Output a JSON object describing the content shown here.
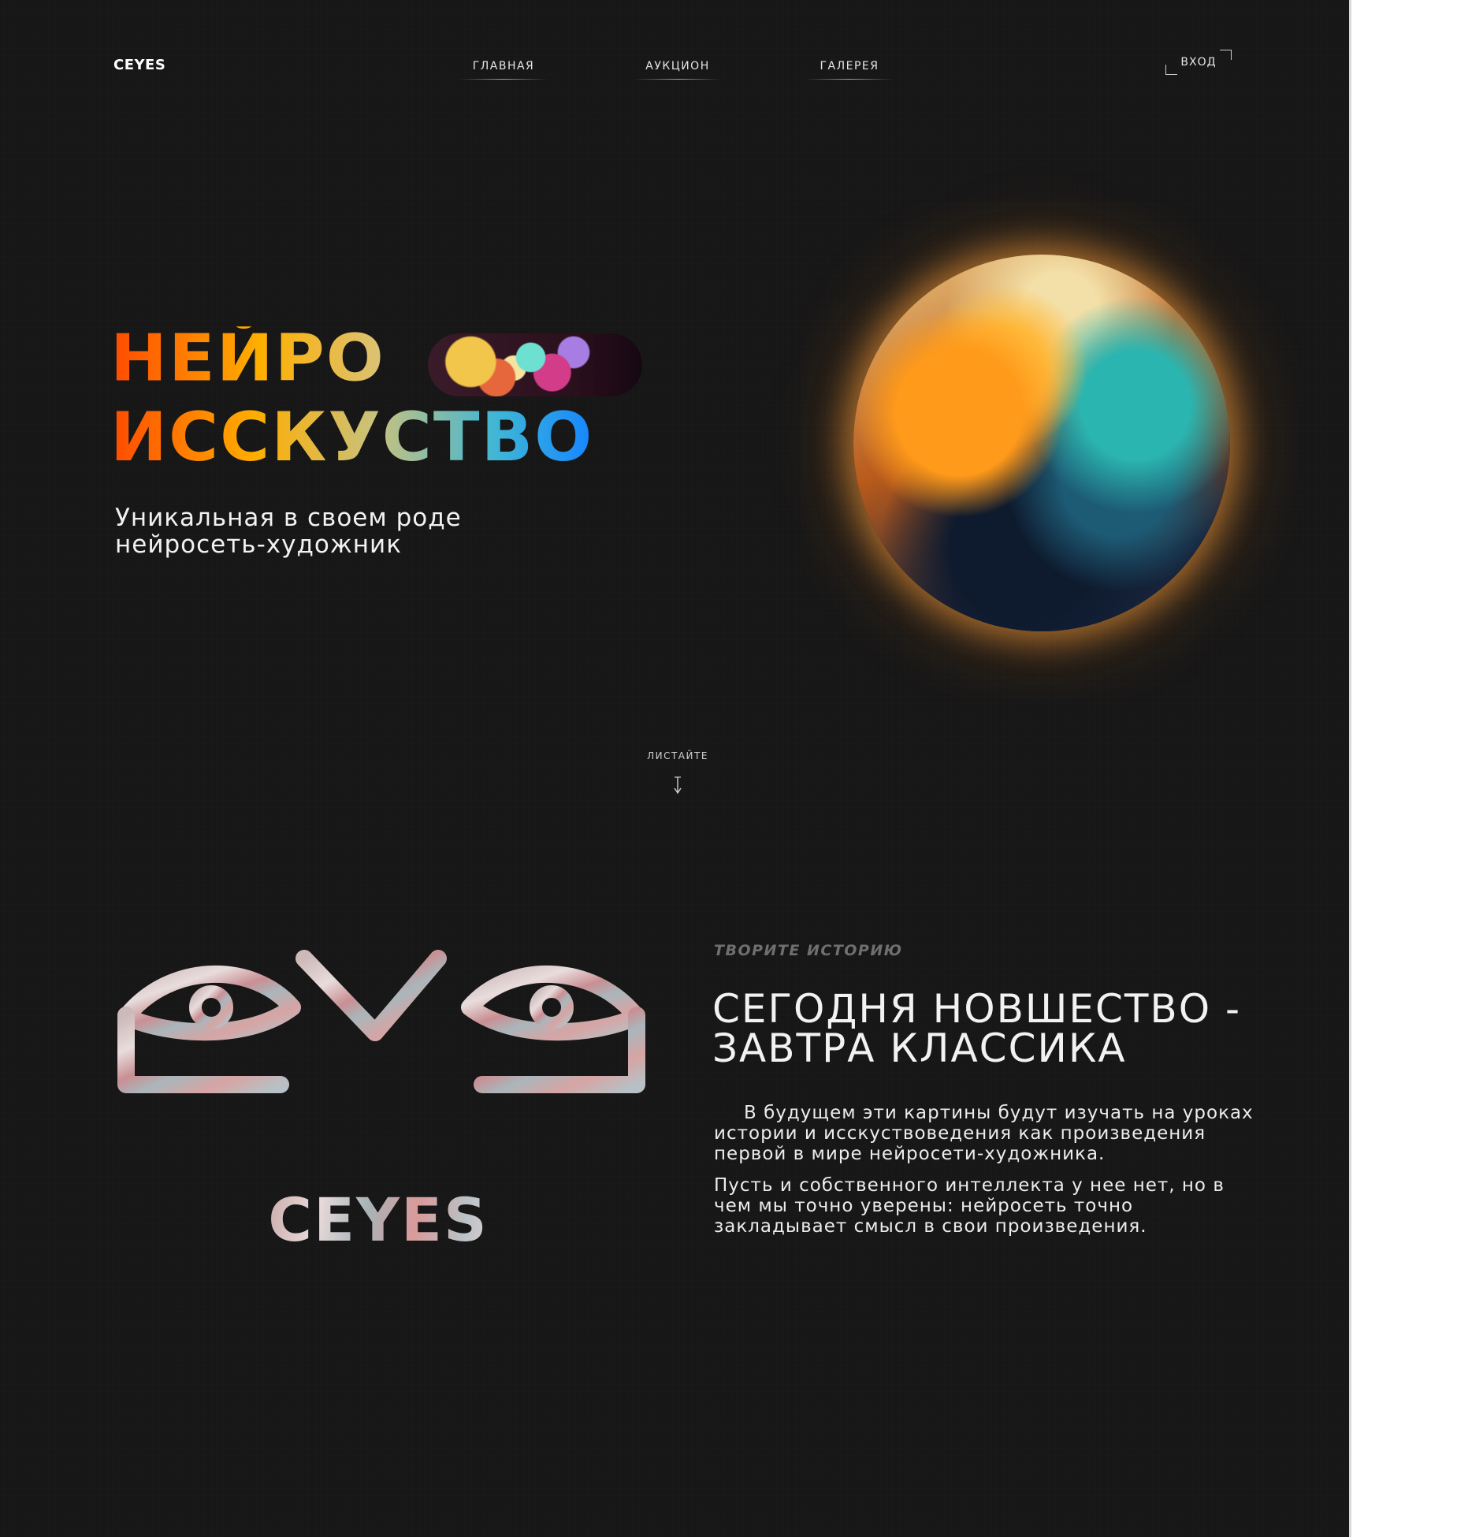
{
  "header": {
    "logo": "CEYES",
    "nav": [
      {
        "label": "ГЛАВНАЯ"
      },
      {
        "label": "АУКЦИОН"
      },
      {
        "label": "ГАЛЕРЕЯ"
      }
    ],
    "login_label": "ВХОД"
  },
  "hero": {
    "title_line1": "НЕЙРО",
    "title_line2": "ИССКУСТВО",
    "subtitle_line1": "Уникальная в своем роде",
    "subtitle_line2": "нейросеть-художник"
  },
  "scroll": {
    "label": "ЛИСТАЙТЕ",
    "icon": "down-arrow-icon"
  },
  "about": {
    "logo_word": "CEYES",
    "eyebrow": "ТВОРИТЕ ИСТОРИЮ",
    "headline_line1": "СЕГОДНЯ НОВШЕСТВО -",
    "headline_line2": "ЗАВТРА КЛАССИКА",
    "paragraph1": "В будущем эти картины будут изучать на уроках истории и исскуствоведения как произведения первой в мире нейросети-художника.",
    "paragraph2": "Пусть и собственного интеллекта у нее нет, но в чем мы точно уверены: нейросеть точно закладывает смысл в свои произведения."
  },
  "colors": {
    "background": "#161616",
    "text": "#f2f2f2",
    "eyebrow": "#6f6f6f",
    "accent_orange": "#ff4a00",
    "accent_blue": "#1586ff"
  }
}
